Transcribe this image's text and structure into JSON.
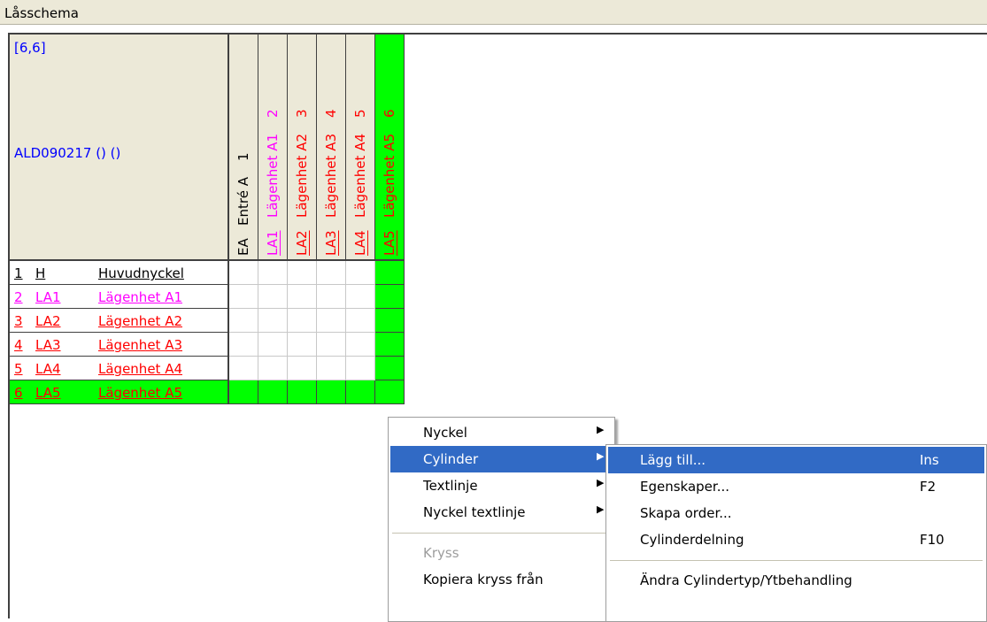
{
  "window": {
    "title": "Låsschema"
  },
  "corner": {
    "coord": "[6,6]",
    "system": "ALD090217 () ()"
  },
  "columns": [
    {
      "num": "1",
      "name": "Entré A",
      "code": "EA",
      "color": "#000000"
    },
    {
      "num": "2",
      "name": "Lägenhet A1",
      "code": "LA1",
      "color": "#ff00ff"
    },
    {
      "num": "3",
      "name": "Lägenhet A2",
      "code": "LA2",
      "color": "#ff0000"
    },
    {
      "num": "4",
      "name": "Lägenhet A3",
      "code": "LA3",
      "color": "#ff0000"
    },
    {
      "num": "5",
      "name": "Lägenhet A4",
      "code": "LA4",
      "color": "#ff0000"
    },
    {
      "num": "6",
      "name": "Lägenhet A5",
      "code": "LA5",
      "color": "#ff0000"
    }
  ],
  "rows": [
    {
      "num": "1",
      "code": "H",
      "name": "Huvudnyckel",
      "color": "#000000"
    },
    {
      "num": "2",
      "code": "LA1",
      "name": "Lägenhet A1",
      "color": "#ff00ff"
    },
    {
      "num": "3",
      "code": "LA2",
      "name": "Lägenhet A2",
      "color": "#ff0000"
    },
    {
      "num": "4",
      "code": "LA3",
      "name": "Lägenhet A3",
      "color": "#ff0000"
    },
    {
      "num": "5",
      "code": "LA4",
      "name": "Lägenhet A4",
      "color": "#ff0000"
    },
    {
      "num": "6",
      "code": "LA5",
      "name": "Lägenhet A5",
      "color": "#ff0000"
    }
  ],
  "selection": {
    "row": 6,
    "column": 6,
    "highlight_color": "#00ff00"
  },
  "context_menu": {
    "items": [
      {
        "label": "Nyckel",
        "submenu": true
      },
      {
        "label": "Cylinder",
        "submenu": true,
        "highlighted": true
      },
      {
        "label": "Textlinje",
        "submenu": true
      },
      {
        "label": "Nyckel textlinje",
        "submenu": true
      },
      {
        "separator": true
      },
      {
        "label": "Kryss",
        "disabled": true
      },
      {
        "label": "Kopiera kryss från"
      }
    ]
  },
  "submenu": {
    "items": [
      {
        "label": "Lägg till...",
        "shortcut": "Ins",
        "highlighted": true
      },
      {
        "label": "Egenskaper...",
        "shortcut": "F2"
      },
      {
        "label": "Skapa order...",
        "shortcut": ""
      },
      {
        "label": "Cylinderdelning",
        "shortcut": "F10"
      },
      {
        "separator": true
      },
      {
        "label": "Ändra Cylindertyp/Ytbehandling",
        "shortcut": ""
      }
    ]
  },
  "icons": {
    "submenu_arrow": "chevron-right-icon"
  },
  "colors": {
    "menu_highlight": "#316ac5",
    "header_bg": "#ece9d8"
  }
}
